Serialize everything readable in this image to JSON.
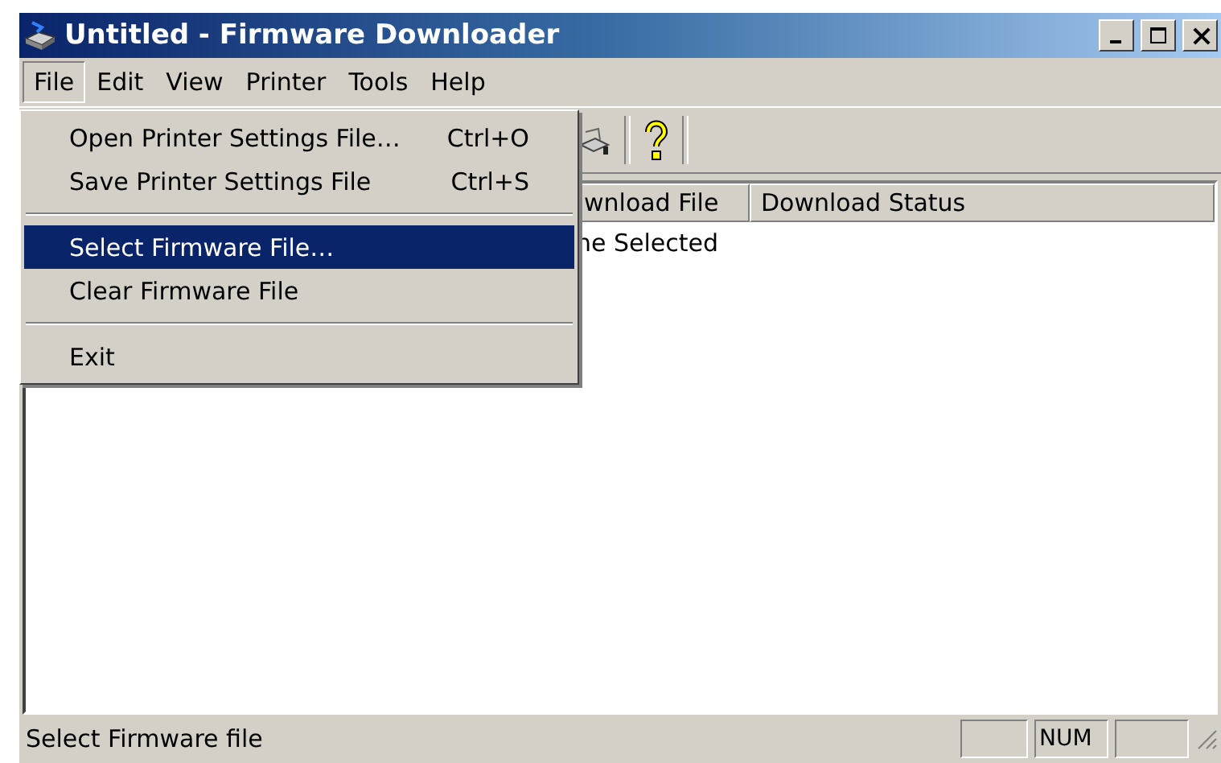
{
  "window": {
    "title": "Untitled - Firmware Downloader"
  },
  "menu_bar": [
    {
      "label": "File",
      "selected": true
    },
    {
      "label": "Edit",
      "selected": false
    },
    {
      "label": "View",
      "selected": false
    },
    {
      "label": "Printer",
      "selected": false
    },
    {
      "label": "Tools",
      "selected": false
    },
    {
      "label": "Help",
      "selected": false
    }
  ],
  "file_menu": [
    {
      "kind": "item",
      "label": "Open Printer Settings File…",
      "shortcut": "Ctrl+O",
      "selected": false
    },
    {
      "kind": "item",
      "label": "Save Printer Settings File",
      "shortcut": "Ctrl+S",
      "selected": false
    },
    {
      "kind": "separator"
    },
    {
      "kind": "item",
      "label": "Select Firmware File…",
      "selected": true
    },
    {
      "kind": "item",
      "label": "Clear Firmware File",
      "selected": false
    },
    {
      "kind": "separator"
    },
    {
      "kind": "item",
      "label": "Exit",
      "selected": false
    }
  ],
  "table": {
    "columns": [
      "wnload File",
      "Download Status"
    ],
    "rows": [
      [
        "ne Selected",
        ""
      ]
    ]
  },
  "status_bar": {
    "text": "Select Firmware file",
    "num_indicator": "NUM"
  }
}
